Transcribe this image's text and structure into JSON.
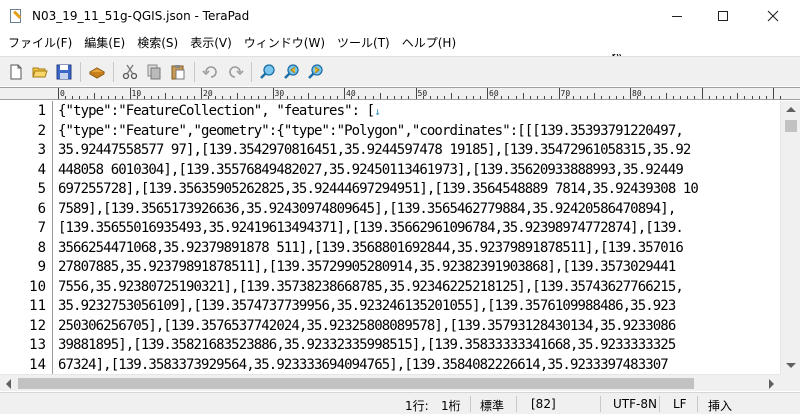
{
  "window": {
    "title": "N03_19_11_51g-QGIS.json - TeraPad"
  },
  "menu": [
    "ファイル(F)",
    "編集(E)",
    "検索(S)",
    "表示(V)",
    "ウィンドウ(W)",
    "ツール(T)",
    "ヘルプ(H)"
  ],
  "toolbar": {
    "buttons": [
      "new-file-icon",
      "open-folder-icon",
      "save-icon",
      "print-icon",
      "cut-icon",
      "copy-icon",
      "paste-icon",
      "undo-icon",
      "redo-icon",
      "find-icon",
      "find-prev-icon",
      "find-next-icon"
    ]
  },
  "ruler": {
    "labels": [
      "0",
      "10",
      "20",
      "30",
      "40",
      "50",
      "60",
      "70",
      "80"
    ]
  },
  "editor": {
    "line_numbers": [
      "1",
      "2",
      "3",
      "4",
      "5",
      "6",
      "7",
      "8",
      "9",
      "10",
      "11",
      "12",
      "13",
      "14"
    ],
    "lines": [
      "{\"type\":\"FeatureCollection\", \"features\": [",
      "{\"type\":\"Feature\",\"geometry\":{\"type\":\"Polygon\",\"coordinates\":[[[139.35393791220497,",
      "35.92447558577 97],[139.3542970816451,35.9244597478 19185],[139.35472961058315,35.92",
      "448058 6010304],[139.35576849482027,35.92450113461973],[139.35620933888993,35.92449",
      "697255728],[139.35635905262825,35.92444697294951],[139.3564548889 7814,35.92439308 10",
      "7589],[139.3565173926636,35.92430974809645],[139.3565462779884,35.92420586470894],",
      "[139.35655016935493,35.92419613494371],[139.35662961096784,35.92398974772874],[139.",
      "3566254471068,35.92379891878 511],[139.3568801692844,35.92379891878511],[139.357016",
      "27807885,35.92379891878511],[139.35729905280914,35.92382391903868],[139.3573029441",
      "7556,35.92380725190321],[139.35738238668785,35.92346225218125],[139.35743627766215,",
      "35.9232753056109],[139.3574737739956,35.923246135201055],[139.3576109988486,35.923",
      "250306256705],[139.3576537742024,35.92325808089578],[139.35793128430134,35.9233086",
      "39881895],[139.35821683523886,35.92332335998515],[139.35833333341668,35.9233333325",
      "67324],[139.3583373929564,35.923333694094765],[139.3584082226614,35.9233397483307"
    ],
    "eol_mark": "↓"
  },
  "status": {
    "line": "1行:",
    "col": "1桁",
    "mode": "標準",
    "code": "[82]",
    "encoding": "UTF-8N",
    "newline": "LF",
    "insert": "挿入"
  }
}
